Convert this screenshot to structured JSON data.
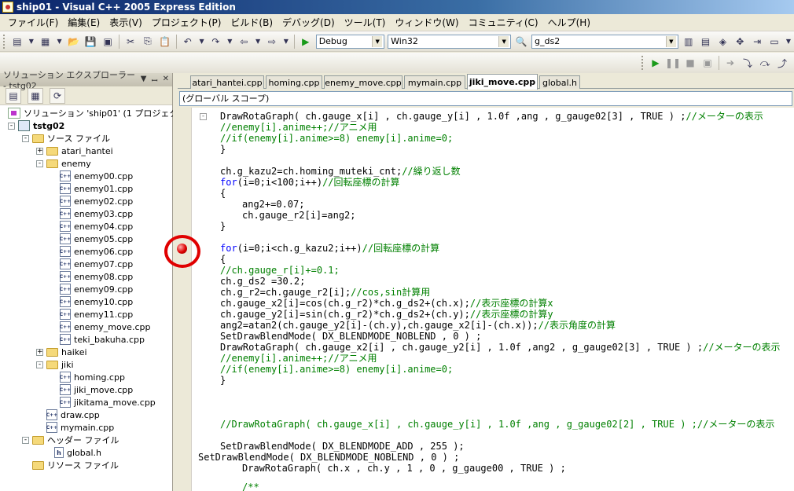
{
  "window": {
    "title": "ship01 - Visual C++ 2005 Express Edition"
  },
  "menu": [
    "ファイル(F)",
    "編集(E)",
    "表示(V)",
    "プロジェクト(P)",
    "ビルド(B)",
    "デバッグ(D)",
    "ツール(T)",
    "ウィンドウ(W)",
    "コミュニティ(C)",
    "ヘルプ(H)"
  ],
  "toolbar": {
    "config": "Debug",
    "platform": "Win32",
    "find": "g_ds2"
  },
  "solution_explorer": {
    "title": "ソリューション エクスプローラー - tstg02",
    "nodes": [
      {
        "label": "ソリューション 'ship01' (1 プロジェクト)",
        "type": "solution"
      },
      {
        "label": "tstg02",
        "type": "project"
      },
      {
        "label": "ソース ファイル",
        "type": "folder"
      },
      {
        "label": "atari_hantei",
        "type": "folder"
      },
      {
        "label": "enemy",
        "type": "folder"
      },
      {
        "label": "enemy00.cpp",
        "type": "cpp"
      },
      {
        "label": "enemy01.cpp",
        "type": "cpp"
      },
      {
        "label": "enemy02.cpp",
        "type": "cpp"
      },
      {
        "label": "enemy03.cpp",
        "type": "cpp"
      },
      {
        "label": "enemy04.cpp",
        "type": "cpp"
      },
      {
        "label": "enemy05.cpp",
        "type": "cpp"
      },
      {
        "label": "enemy06.cpp",
        "type": "cpp"
      },
      {
        "label": "enemy07.cpp",
        "type": "cpp"
      },
      {
        "label": "enemy08.cpp",
        "type": "cpp"
      },
      {
        "label": "enemy09.cpp",
        "type": "cpp"
      },
      {
        "label": "enemy10.cpp",
        "type": "cpp"
      },
      {
        "label": "enemy11.cpp",
        "type": "cpp"
      },
      {
        "label": "enemy_move.cpp",
        "type": "cpp"
      },
      {
        "label": "teki_bakuha.cpp",
        "type": "cpp"
      },
      {
        "label": "haikei",
        "type": "folder"
      },
      {
        "label": "jiki",
        "type": "folder"
      },
      {
        "label": "homing.cpp",
        "type": "cpp"
      },
      {
        "label": "jiki_move.cpp",
        "type": "cpp"
      },
      {
        "label": "jikitama_move.cpp",
        "type": "cpp"
      },
      {
        "label": "draw.cpp",
        "type": "cpp"
      },
      {
        "label": "mymain.cpp",
        "type": "cpp"
      },
      {
        "label": "ヘッダー ファイル",
        "type": "folder"
      },
      {
        "label": "global.h",
        "type": "h"
      },
      {
        "label": "リソース ファイル",
        "type": "folder"
      }
    ]
  },
  "tabs": [
    "atari_hantei.cpp",
    "homing.cpp",
    "enemy_move.cpp",
    "mymain.cpp",
    "jiki_move.cpp",
    "global.h"
  ],
  "active_tab": "jiki_move.cpp",
  "scope": "(グローバル スコープ)",
  "code_lines": [
    "DrawRotaGraph( ch.gauge_x[i] , ch.gauge_y[i] , 1.0f ,ang , g_gauge02[3] , TRUE ) ;//メーターの表示",
    "//enemy[i].anime++;//アニメ用",
    "//if(enemy[i].anime>=8) enemy[i].anime=0;",
    "}",
    "ch.g_kazu2=ch.homing_muteki_cnt;//繰り返し数",
    "for(i=0;i<100;i++)//回転座標の計算",
    "{",
    "ang2+=0.07;",
    "ch.gauge_r2[i]=ang2;",
    "}",
    "for(i=0;i<ch.g_kazu2;i++)//回転座標の計算",
    "{",
    "//ch.gauge_r[i]+=0.1;",
    "ch.g_ds2 =30.2;",
    "ch.g_r2=ch.gauge_r2[i];//cos,sin計算用",
    "ch.gauge_x2[i]=cos(ch.g_r2)*ch.g_ds2+(ch.x);//表示座標の計算x",
    "ch.gauge_y2[i]=sin(ch.g_r2)*ch.g_ds2+(ch.y);//表示座標の計算y",
    "ang2=atan2(ch.gauge_y2[i]-(ch.y),ch.gauge_x2[i]-(ch.x));//表示角度の計算",
    "SetDrawBlendMode( DX_BLENDMODE_NOBLEND , 0 ) ;",
    "DrawRotaGraph( ch.gauge_x2[i] , ch.gauge_y2[i] , 1.0f ,ang2 , g_gauge02[3] , TRUE ) ;//メーターの表示",
    "//enemy[i].anime++;//アニメ用",
    "//if(enemy[i].anime>=8) enemy[i].anime=0;",
    "}",
    "//DrawRotaGraph( ch.gauge_x[i] , ch.gauge_y[i] , 1.0f ,ang , g_gauge02[2] , TRUE ) ;//メーターの表示",
    "SetDrawBlendMode( DX_BLENDMODE_ADD , 255 );",
    "SetDrawBlendMode( DX_BLENDMODE_NOBLEND , 0 ) ;",
    "DrawRotaGraph( ch.x , ch.y , 1 , 0 , g_gauge00 , TRUE ) ;",
    "/**"
  ],
  "breakpoint": {
    "line": "for(i=0;i<ch.g_kazu2;i++)//回転座標の計算",
    "highlight_color": "#e00000"
  }
}
